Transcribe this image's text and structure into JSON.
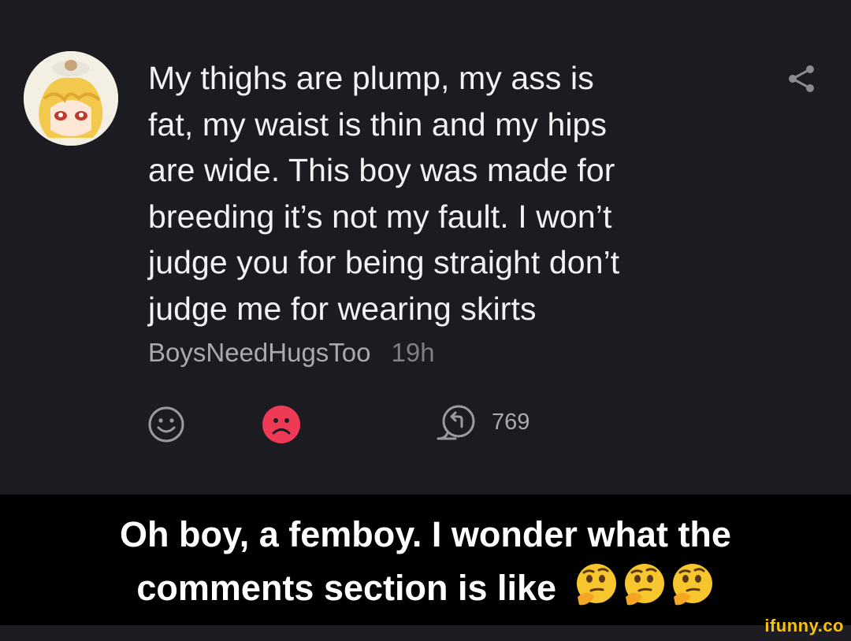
{
  "post": {
    "lines": [
      "My thighs are plump, my ass is",
      "fat, my waist is thin and my hips",
      "are wide. This boy was made for",
      "breeding it’s not my fault. I won’t",
      "judge you for being straight don’t",
      "judge me for wearing skirts"
    ],
    "username": "BoysNeedHugsToo",
    "time": "19h",
    "reply_count": "769"
  },
  "icons": {
    "avatar": "anime-character-avatar",
    "share": "share-icon",
    "smile": "smile-face-icon",
    "frown": "frown-face-icon",
    "reply": "reply-icon"
  },
  "colors": {
    "post_background": "#1c1b21",
    "frown_active": "#ef3a56",
    "caption_background": "#000000",
    "watermark": "#f6c20f"
  },
  "caption": {
    "line1": "Oh boy, a femboy. I wonder what the",
    "line2": "comments section is like",
    "emoji": [
      "thinking-face",
      "thinking-face",
      "thinking-face"
    ]
  },
  "watermark": "ifunny.co"
}
